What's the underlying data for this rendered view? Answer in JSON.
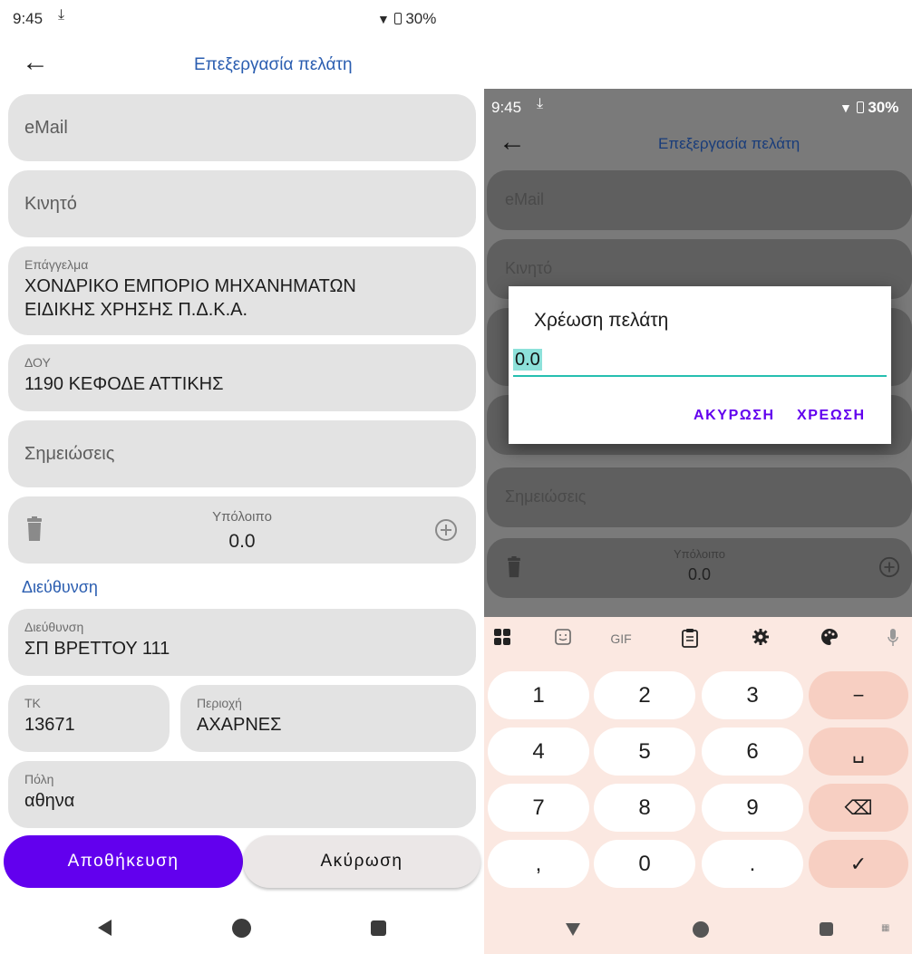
{
  "left": {
    "status": {
      "time": "9:45",
      "battery": "30%"
    },
    "app_title": "Επεξεργασία πελάτη",
    "fields": {
      "email_hint": "eMail",
      "mobile_hint": "Κινητό",
      "profession_label": "Επάγγελμα",
      "profession_line1": "ΧΟΝΔΡΙΚΟ ΕΜΠΟΡΙΟ ΜΗΧΑΝΗΜΑΤΩΝ",
      "profession_line2": "ΕΙΔΙΚΗΣ ΧΡΗΣΗΣ Π.Δ.Κ.Α.",
      "tax_office_label": "ΔΟΥ",
      "tax_office_value": "1190 ΚΕΦΟΔΕ ΑΤΤΙΚΗΣ",
      "notes_hint": "Σημειώσεις"
    },
    "balance": {
      "label": "Υπόλοιπο",
      "value": "0.0"
    },
    "address_section": "Διεύθυνση",
    "address": {
      "address_label": "Διεύθυνση",
      "address_value": "ΣΠ ΒΡΕΤΤΟΥ 111",
      "zip_label": "ΤΚ",
      "zip_value": "13671",
      "area_label": "Περιοχή",
      "area_value": "ΑΧΑΡΝΕΣ",
      "city_label": "Πόλη",
      "city_value": "αθηνα"
    },
    "buttons": {
      "save": "Αποθήκευση",
      "cancel": "Ακύρωση"
    }
  },
  "right": {
    "status": {
      "time": "9:45",
      "battery": "30%"
    },
    "app_title": "Επεξεργασία πελάτη",
    "email_hint": "eMail",
    "mobile_hint": "Κινητό",
    "notes_hint": "Σημειώσεις",
    "balance": {
      "label": "Υπόλοιπο",
      "value": "0.0"
    },
    "dialog": {
      "title": "Χρέωση πελάτη",
      "input_value": "0.0",
      "cancel": "ΑΚΥΡΩΣΗ",
      "charge": "ΧΡΕΩΣΗ"
    },
    "keyboard": {
      "tools": [
        "apps-icon",
        "sticker-icon",
        "GIF",
        "clipboard-icon",
        "settings-icon",
        "palette-icon",
        "mic-icon"
      ],
      "gif_label": "GIF",
      "rows": [
        [
          "1",
          "2",
          "3",
          "−"
        ],
        [
          "4",
          "5",
          "6",
          "␣"
        ],
        [
          "7",
          "8",
          "9",
          "⌫"
        ],
        [
          ",",
          "0",
          ".",
          "✓"
        ]
      ]
    }
  },
  "colors": {
    "accent": "#6200ee",
    "title_blue": "#2a5db0",
    "field_bg": "#e3e3e3",
    "input_underline": "#26bfb0",
    "keyboard_bg": "#fbe8e1"
  }
}
